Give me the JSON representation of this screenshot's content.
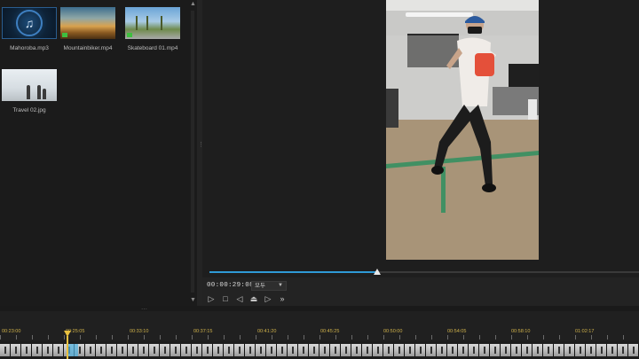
{
  "media_library": {
    "items": [
      {
        "name": "Mahoroba.mp3",
        "type": "audio",
        "icon": "music-note-icon"
      },
      {
        "name": "Mountainbiker.mp4",
        "type": "video"
      },
      {
        "name": "Skateboard 01.mp4",
        "type": "video"
      },
      {
        "name": "Travel 02.jpg",
        "type": "image"
      }
    ]
  },
  "preview": {
    "timecode": "00:00:29:08",
    "quality": "모두",
    "progress_fraction": 0.39,
    "controls": [
      "play-icon",
      "stop-icon",
      "prev-frame-icon",
      "snapshot-icon",
      "next-frame-icon",
      "fast-forward-icon"
    ]
  },
  "timeline": {
    "ruler_labels": [
      "00:23:00",
      "00:25:05",
      "00:33:10",
      "00:37:15",
      "00:41:20",
      "00:45:25",
      "00:50:00",
      "00:54:05",
      "00:58:10",
      "01:02:17"
    ],
    "playhead_label": "00:25:05"
  },
  "colors": {
    "accent_blue": "#2f9ad6",
    "playhead": "#e8c040",
    "ruler_text": "#d0b24a"
  }
}
